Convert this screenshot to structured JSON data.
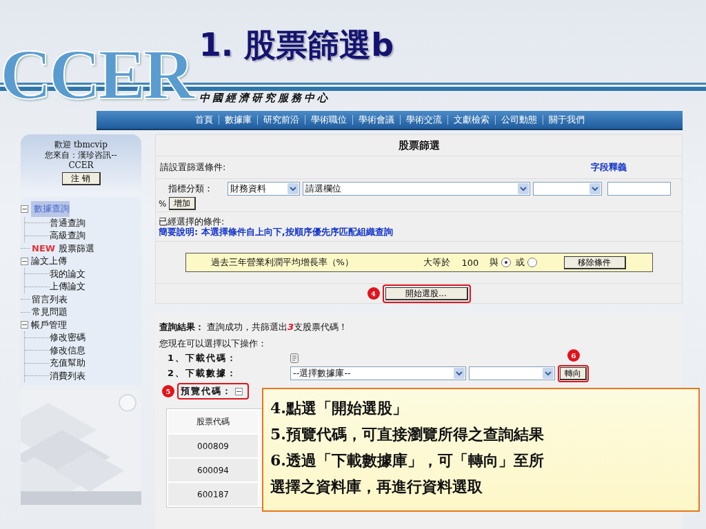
{
  "slide": {
    "logo": "CCER",
    "title": "1. 股票篩選b",
    "subtitle": "中國經濟研究服務中心"
  },
  "nav": [
    "首頁",
    "數據庫",
    "研究前沿",
    "學術職位",
    "學術會議",
    "學術交流",
    "文獻檢索",
    "公司動態",
    "關于我們"
  ],
  "sidebar": {
    "welcome": "歡迎 tbmcvip",
    "from": "您來自：漢珍咨訊--CCER",
    "logout": "注 销",
    "tree": [
      {
        "label": "數據查詢",
        "selected": true,
        "expanded": true,
        "children": [
          {
            "label": "普通查詢",
            "selected": false
          },
          {
            "label": "高級查詢",
            "selected": false
          }
        ]
      },
      {
        "label": "股票篩選",
        "badge": "NEW",
        "selected": false
      },
      {
        "label": "論文上傳",
        "selected": false,
        "expanded": true,
        "children": [
          {
            "label": "我的論文",
            "selected": false
          },
          {
            "label": "上傳論文",
            "selected": false
          }
        ]
      },
      {
        "label": "留言列表",
        "selected": false
      },
      {
        "label": "常見問題",
        "selected": false
      },
      {
        "label": "帳戶管理",
        "selected": false,
        "expanded": true,
        "children": [
          {
            "label": "修改密碼",
            "selected": false
          },
          {
            "label": "修改信息",
            "selected": false
          },
          {
            "label": "充值幫助",
            "selected": false
          },
          {
            "label": "消費列表",
            "selected": false
          }
        ]
      }
    ]
  },
  "filter": {
    "title": "股票篩選",
    "prompt": "請設置篩選條件:",
    "help_link": "字段釋義",
    "category_label": "指標分類：",
    "category_select": "財務資料",
    "field_select": "請選欄位",
    "percent": "%",
    "add_button": "增加",
    "selected_label": "已經選擇的條件:",
    "note": "簡要說明: 本選擇條件自上向下,按順序優先序匹配組織查詢",
    "conditions": [
      {
        "name": "過去三年營業利潤平均增長率（%）",
        "operator": "大等於",
        "value": "100",
        "logic": [
          {
            "label": "與",
            "selected": true
          },
          {
            "label": "或",
            "selected": false
          }
        ],
        "remove_button": "移除條件"
      }
    ],
    "start_button": "開始選股...",
    "start_step": "4"
  },
  "results": {
    "label": "查詢結果：",
    "text": "查詢成功，共篩選出**3**支股票代碼！",
    "intro": "您現在可以選擇以下操作：",
    "actions": [
      {
        "kind": "icon",
        "label": "1、下載代碼："
      },
      {
        "kind": "select",
        "label": "2、下載數據：",
        "select": "--選擇數據庫--",
        "button": "轉向",
        "step": "6"
      },
      {
        "kind": "toggle",
        "label": "預覽代碼：",
        "step": "5",
        "expanded": true
      }
    ],
    "table": {
      "columns": [
        "股票代碼"
      ],
      "rows": [
        "000809",
        "600094",
        "600187"
      ]
    }
  },
  "callout": [
    "4.點選「開始選股」",
    "5.預覽代碼，可直接瀏覽所得之查詢結果",
    "6.透過「下載數據庫」，可「轉向」至所",
    "選擇之資料庫，再進行資料選取"
  ]
}
